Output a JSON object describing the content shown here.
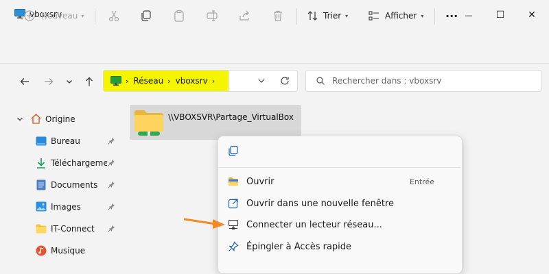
{
  "window": {
    "title": "vboxsrv",
    "minimize_glyph": "—",
    "maximize_glyph": "☐",
    "close_glyph": "✕"
  },
  "toolbar": {
    "new_label": "Nouveau",
    "sort_label": "Trier",
    "view_label": "Afficher",
    "more_glyph": "···",
    "icons": [
      "cut-icon",
      "copy-icon",
      "paste-icon",
      "rename-icon",
      "share-icon",
      "delete-icon"
    ]
  },
  "address": {
    "crumbs": [
      "Réseau",
      "vboxsrv"
    ],
    "highlight_color": "#f5f500"
  },
  "search": {
    "placeholder": "Rechercher dans : vboxsrv"
  },
  "sidebar": {
    "items": [
      {
        "label": "Origine",
        "icon": "home-icon",
        "pinned": false
      },
      {
        "label": "Bureau",
        "icon": "desktop-folder-icon",
        "pinned": true
      },
      {
        "label": "Téléchargements",
        "icon": "download-icon",
        "pinned": true
      },
      {
        "label": "Documents",
        "icon": "documents-icon",
        "pinned": true
      },
      {
        "label": "Images",
        "icon": "images-icon",
        "pinned": true
      },
      {
        "label": "IT-Connect",
        "icon": "folder-icon",
        "pinned": true
      },
      {
        "label": "Musique",
        "icon": "music-icon",
        "pinned": false
      }
    ]
  },
  "content": {
    "folder": {
      "label": "\\\\VBOXSVR\\Partage_VirtualBox"
    }
  },
  "context_menu": {
    "items": [
      {
        "label": "Ouvrir",
        "shortcut": "Entrée",
        "icon": "open-folder-icon"
      },
      {
        "label": "Ouvrir dans une nouvelle fenêtre",
        "icon": "new-window-icon"
      },
      {
        "label": "Connecter un lecteur réseau...",
        "icon": "network-drive-icon"
      },
      {
        "label": "Épingler à Accès rapide",
        "icon": "pin-icon"
      }
    ]
  },
  "colors": {
    "accent_arrow": "#f08a24",
    "highlight": "#f5f500",
    "selection": "#d8d8d8"
  }
}
